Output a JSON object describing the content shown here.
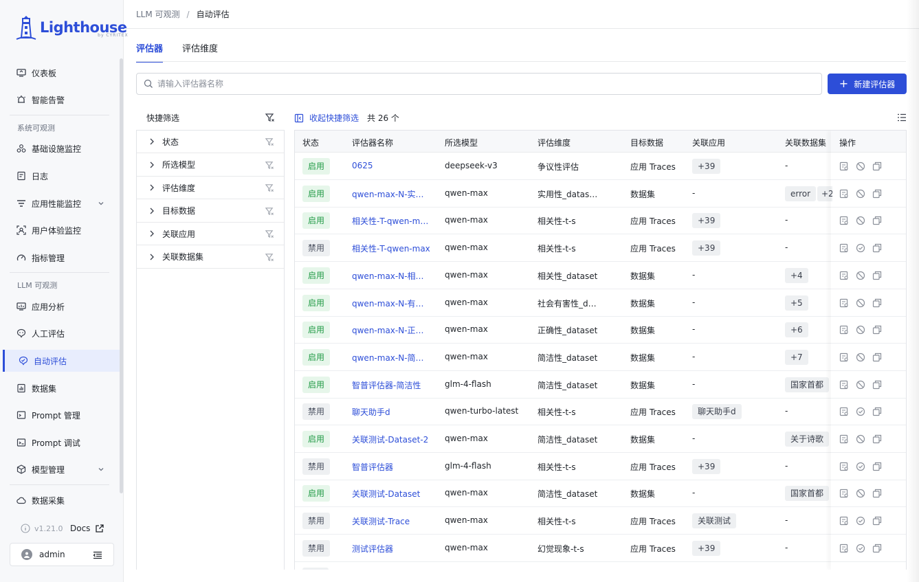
{
  "brand": {
    "name": "Lighthouse",
    "sub": "by CYRITEX"
  },
  "sidebar": {
    "items_top": [
      {
        "label": "仪表板",
        "icon": "dashboard-icon"
      },
      {
        "label": "智能告警",
        "icon": "alarm-icon"
      }
    ],
    "group1": "系统可观测",
    "items_sys": [
      {
        "label": "基础设施监控",
        "icon": "infra-icon"
      },
      {
        "label": "日志",
        "icon": "log-icon"
      },
      {
        "label": "应用性能监控",
        "icon": "apm-icon"
      },
      {
        "label": "用户体验监控",
        "icon": "ux-icon"
      },
      {
        "label": "指标管理",
        "icon": "gauge-icon"
      }
    ],
    "group2": "LLM 可观测",
    "items_llm": [
      {
        "label": "应用分析",
        "icon": "app-analysis-icon"
      },
      {
        "label": "人工评估",
        "icon": "manual-eval-icon"
      },
      {
        "label": "自动评估",
        "icon": "auto-eval-icon"
      },
      {
        "label": "数据集",
        "icon": "dataset-icon"
      },
      {
        "label": "Prompt 管理",
        "icon": "prompt-icon"
      },
      {
        "label": "Prompt 调试",
        "icon": "prompt-debug-icon"
      },
      {
        "label": "模型管理",
        "icon": "model-icon"
      }
    ],
    "items_bottom": [
      {
        "label": "数据采集",
        "icon": "collect-icon"
      }
    ],
    "version": "v1.21.0",
    "docs": "Docs",
    "user": "admin"
  },
  "breadcrumb": {
    "parent": "LLM 可观测",
    "sep": "/",
    "current": "自动评估"
  },
  "tabs": [
    "评估器",
    "评估维度"
  ],
  "search": {
    "placeholder": "请输入评估器名称",
    "value": ""
  },
  "new_button": "新建评估器",
  "filter": {
    "title": "快捷筛选",
    "rows": [
      "状态",
      "所选模型",
      "评估维度",
      "目标数据",
      "关联应用",
      "关联数据集"
    ]
  },
  "table_bar": {
    "collapse": "收起快捷筛选",
    "total": "共 26 个"
  },
  "table": {
    "headers": [
      "状态",
      "评估器名称",
      "所选模型",
      "评估维度",
      "目标数据",
      "关联应用",
      "关联数据集",
      "操作"
    ],
    "rows": [
      {
        "status": "启用",
        "on": true,
        "name": "0625",
        "model": "deepseek-v3",
        "dim": "争议性评估",
        "target": "应用 Traces",
        "app": "+39",
        "app_tag": true,
        "ds": "-",
        "ds_tag": false,
        "ds_extra": ""
      },
      {
        "status": "启用",
        "on": true,
        "name": "qwen-max-N-实…",
        "model": "qwen-max",
        "dim": "实用性_datas…",
        "target": "数据集",
        "app": "-",
        "app_tag": false,
        "ds": "error",
        "ds_tag": true,
        "ds_extra": "+2"
      },
      {
        "status": "启用",
        "on": true,
        "name": "相关性-T-qwen-m…",
        "model": "qwen-max",
        "dim": "相关性-t-s",
        "target": "应用 Traces",
        "app": "+39",
        "app_tag": true,
        "ds": "-",
        "ds_tag": false,
        "ds_extra": ""
      },
      {
        "status": "禁用",
        "on": false,
        "name": "相关性-T-qwen-max",
        "model": "qwen-max",
        "dim": "相关性-t-s",
        "target": "应用 Traces",
        "app": "+39",
        "app_tag": true,
        "ds": "-",
        "ds_tag": false,
        "ds_extra": ""
      },
      {
        "status": "启用",
        "on": true,
        "name": "qwen-max-N-相…",
        "model": "qwen-max",
        "dim": "相关性_dataset",
        "target": "数据集",
        "app": "-",
        "app_tag": false,
        "ds": "+4",
        "ds_tag": true,
        "ds_extra": ""
      },
      {
        "status": "启用",
        "on": true,
        "name": "qwen-max-N-有…",
        "model": "qwen-max",
        "dim": "社会有害性_d…",
        "target": "数据集",
        "app": "-",
        "app_tag": false,
        "ds": "+5",
        "ds_tag": true,
        "ds_extra": ""
      },
      {
        "status": "启用",
        "on": true,
        "name": "qwen-max-N-正…",
        "model": "qwen-max",
        "dim": "正确性_dataset",
        "target": "数据集",
        "app": "-",
        "app_tag": false,
        "ds": "+6",
        "ds_tag": true,
        "ds_extra": ""
      },
      {
        "status": "启用",
        "on": true,
        "name": "qwen-max-N-简…",
        "model": "qwen-max",
        "dim": "简洁性_dataset",
        "target": "数据集",
        "app": "-",
        "app_tag": false,
        "ds": "+7",
        "ds_tag": true,
        "ds_extra": ""
      },
      {
        "status": "启用",
        "on": true,
        "name": "智普评估器-简洁性",
        "model": "glm-4-flash",
        "dim": "简洁性_dataset",
        "target": "数据集",
        "app": "-",
        "app_tag": false,
        "ds": "国家首都",
        "ds_tag": true,
        "ds_extra": ""
      },
      {
        "status": "禁用",
        "on": false,
        "name": "聊天助手d",
        "model": "qwen-turbo-latest",
        "dim": "相关性-t-s",
        "target": "应用 Traces",
        "app": "聊天助手d",
        "app_tag": true,
        "ds": "-",
        "ds_tag": false,
        "ds_extra": ""
      },
      {
        "status": "启用",
        "on": true,
        "name": "关联测试-Dataset-2",
        "model": "qwen-max",
        "dim": "简洁性_dataset",
        "target": "数据集",
        "app": "-",
        "app_tag": false,
        "ds": "关于诗歌",
        "ds_tag": true,
        "ds_extra": ""
      },
      {
        "status": "禁用",
        "on": false,
        "name": "智普评估器",
        "model": "glm-4-flash",
        "dim": "相关性-t-s",
        "target": "应用 Traces",
        "app": "+39",
        "app_tag": true,
        "ds": "-",
        "ds_tag": false,
        "ds_extra": ""
      },
      {
        "status": "启用",
        "on": true,
        "name": "关联测试-Dataset",
        "model": "qwen-max",
        "dim": "简洁性_dataset",
        "target": "数据集",
        "app": "-",
        "app_tag": false,
        "ds": "国家首都",
        "ds_tag": true,
        "ds_extra": ""
      },
      {
        "status": "禁用",
        "on": false,
        "name": "关联测试-Trace",
        "model": "qwen-max",
        "dim": "相关性-t-s",
        "target": "应用 Traces",
        "app": "关联测试",
        "app_tag": true,
        "ds": "-",
        "ds_tag": false,
        "ds_extra": ""
      },
      {
        "status": "禁用",
        "on": false,
        "name": "测试评估器",
        "model": "qwen-max",
        "dim": "幻觉现象-t-s",
        "target": "应用 Traces",
        "app": "+39",
        "app_tag": true,
        "ds": "-",
        "ds_tag": false,
        "ds_extra": ""
      }
    ]
  },
  "colors": {
    "accent": "#2d4ed8",
    "enabled_bg": "#e6f6ea",
    "enabled_fg": "#239b47",
    "disabled_bg": "#eef0f2"
  }
}
